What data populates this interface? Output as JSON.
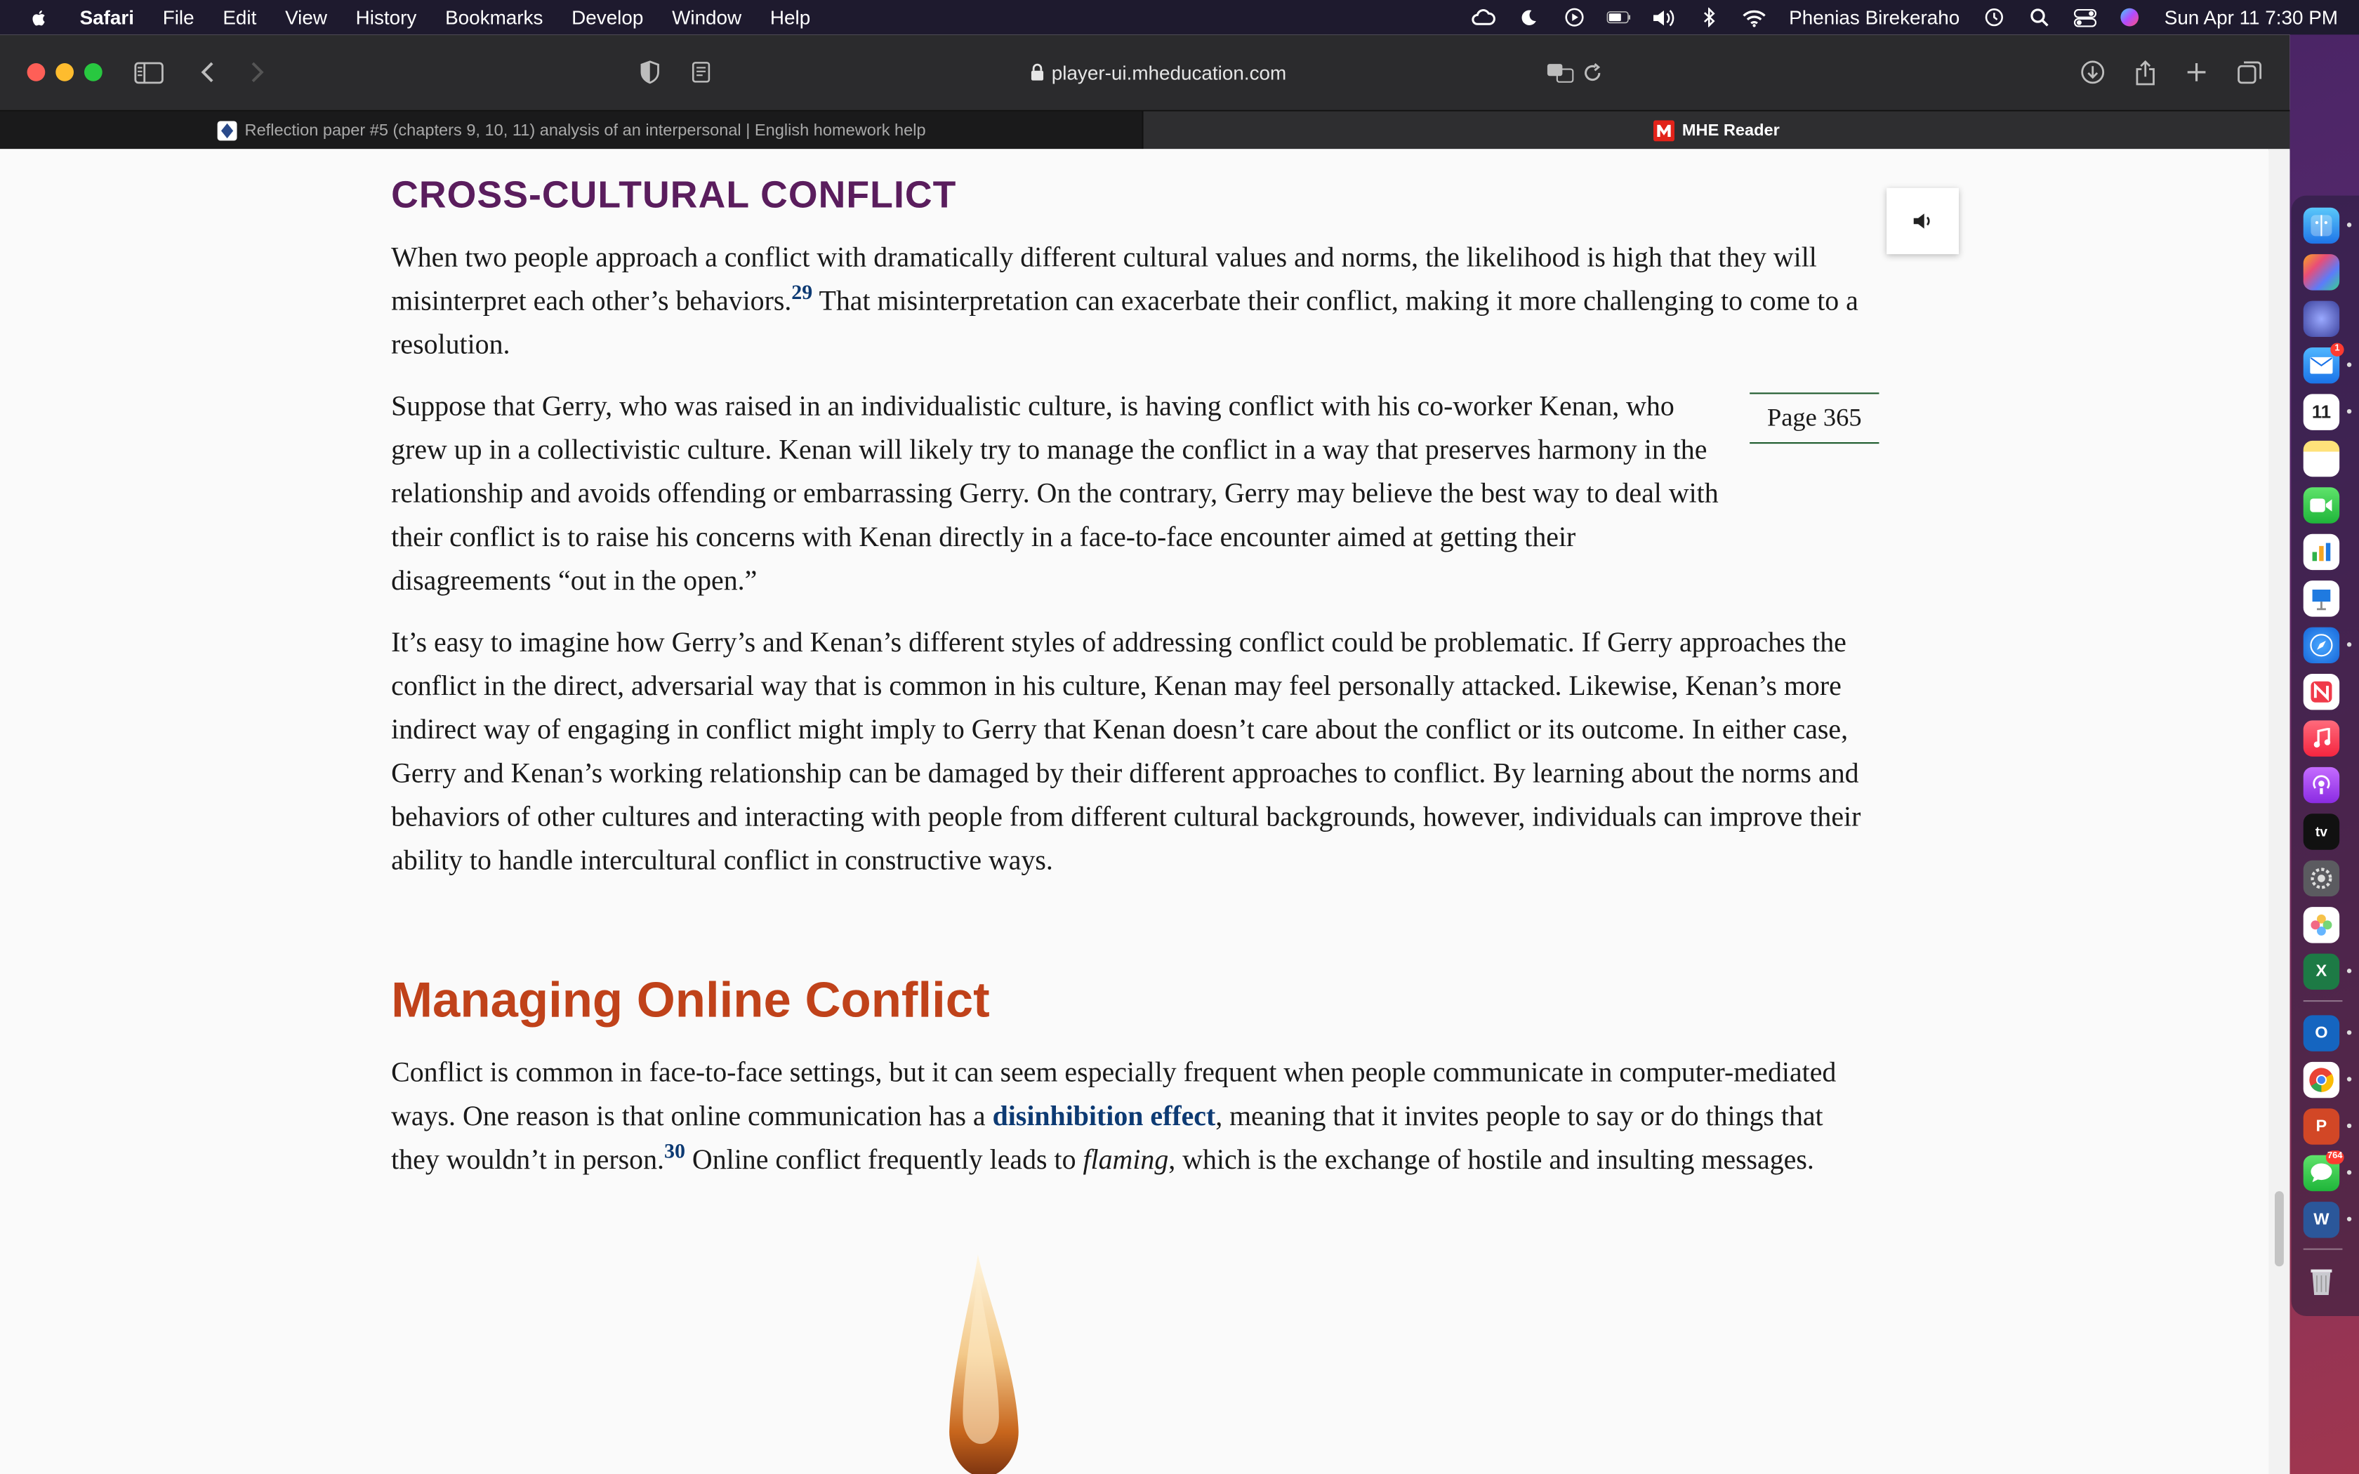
{
  "menubar": {
    "app": "Safari",
    "items": [
      "File",
      "Edit",
      "View",
      "History",
      "Bookmarks",
      "Develop",
      "Window",
      "Help"
    ],
    "user": "Phenias Birekeraho",
    "datetime": "Sun Apr 11  7:30 PM"
  },
  "toolbar": {
    "url": "player-ui.mheducation.com"
  },
  "tabs": [
    {
      "label": "Reflection paper #5 (chapters 9, 10, 11) analysis of an interpersonal | English homework help",
      "active": false
    },
    {
      "label": "MHE Reader",
      "active": true
    }
  ],
  "article": {
    "heading1": "CROSS-CULTURAL CONFLICT",
    "p1_a": "When two people approach a conflict with dramatically different cultural values and norms, the likelihood is high that they will misinterpret each other’s behaviors.",
    "p1_sup": "29",
    "p1_b": " That misinterpretation can exacerbate their conflict, making it more challenging to come to a resolution.",
    "page_marker": "Page 365",
    "p2": "Suppose that Gerry, who was raised in an individualistic culture, is having conflict with his co-worker Kenan, who grew up in a collectivistic culture. Kenan will likely try to manage the conflict in a way that preserves harmony in the relationship and avoids offending or embarrassing Gerry. On the contrary, Gerry may believe the best way to deal with their conflict is to raise his concerns with Kenan directly in a face-to-face encounter aimed at getting their disagreements “out in the open.”",
    "p3": "It’s easy to imagine how Gerry’s and Kenan’s different styles of addressing conflict could be problematic. If Gerry approaches the conflict in the direct, adversarial way that is common in his culture, Kenan may feel personally attacked. Likewise, Kenan’s more indirect way of engaging in conflict might imply to Gerry that Kenan doesn’t care about the conflict or its outcome. In either case, Gerry and Kenan’s working relationship can be damaged by their different approaches to conflict. By learning about the norms and behaviors of other cultures and interacting with people from different cultural backgrounds, however, individuals can improve their ability to handle intercultural conflict in constructive ways.",
    "heading2": "Managing Online Conflict",
    "p4_a": "Conflict is common in face-to-face settings, but it can seem especially frequent when people communicate in computer-mediated ways. One reason is that online communication has a ",
    "p4_term": "disinhibition effect",
    "p4_b": ", meaning that it invites people to say or do things that they wouldn’t in person.",
    "p4_sup": "30",
    "p4_c": " Online conflict frequently leads to ",
    "p4_italic": "flaming",
    "p4_d": ", which is the exchange of hostile and insulting messages."
  },
  "dock": {
    "calendar_day": "11",
    "mail_badge": "1",
    "messages_badge": "764",
    "tv_label": "tv",
    "excel_label": "X",
    "outlook_label": "O",
    "powerpoint_label": "P",
    "word_label": "W"
  }
}
